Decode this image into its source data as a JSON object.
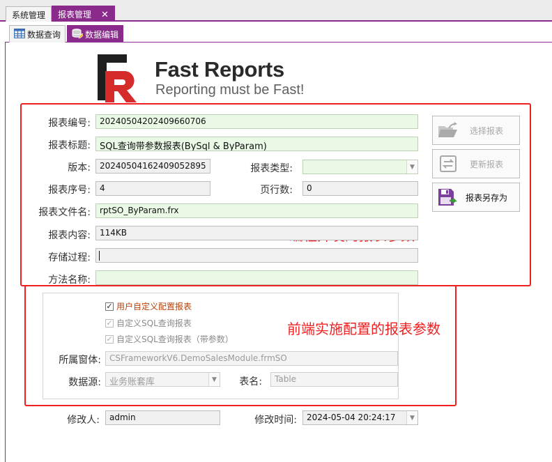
{
  "top_tabs": [
    {
      "label": "系统管理"
    },
    {
      "label": "报表管理",
      "close": "✕"
    }
  ],
  "sub_tabs": [
    {
      "label": "数据查询"
    },
    {
      "label": "数据编辑"
    }
  ],
  "logo": {
    "title": "Fast Reports",
    "tagline": "Reporting must be Fast!"
  },
  "form": {
    "report_no": {
      "label": "报表编号:",
      "value": "20240504202409660706"
    },
    "report_title": {
      "label": "报表标题:",
      "value": "SQL查询带参数报表(BySql & ByParam)"
    },
    "version": {
      "label": "版本:",
      "value": "20240504162409052895"
    },
    "report_type": {
      "label": "报表类型:",
      "value": ""
    },
    "report_seq": {
      "label": "报表序号:",
      "value": "4"
    },
    "page_rows": {
      "label": "页行数:",
      "value": "0"
    },
    "file_name": {
      "label": "报表文件名:",
      "value": "rptSO_ByParam.frx"
    },
    "content": {
      "label": "报表内容:",
      "value": "114KB"
    },
    "stored_proc": {
      "label": "存储过程:",
      "value": ""
    },
    "method_name": {
      "label": "方法名称:",
      "value": ""
    }
  },
  "buttons": {
    "select_report": "选择报表",
    "update_report": "更新报表",
    "save_as": "报表另存为"
  },
  "annotations": {
    "dev_params": "编程开发的报表参数",
    "frontend_params": "前端实施配置的报表参数"
  },
  "config": {
    "user_custom": {
      "label": "用户自定义配置报表",
      "checked": true
    },
    "custom_sql": {
      "label": "自定义SQL查询报表",
      "checked": true
    },
    "custom_sql_param": {
      "label": "自定义SQL查询报表（带参数）",
      "checked": true
    },
    "window": {
      "label": "所属窗体:",
      "value": "CSFrameworkV6.DemoSalesModule.frmSO"
    },
    "datasource": {
      "label": "数据源:",
      "value": "业务账套库"
    },
    "table_name": {
      "label": "表名:",
      "value": "Table"
    }
  },
  "footer": {
    "modifier": {
      "label": "修改人:",
      "value": "admin"
    },
    "modified_time": {
      "label": "修改时间:",
      "value": "2024-05-04 20:24:17"
    }
  },
  "colors": {
    "accent": "#8a2b8c",
    "annotation_red": "#f02020",
    "field_green": "#eaf9e6"
  }
}
